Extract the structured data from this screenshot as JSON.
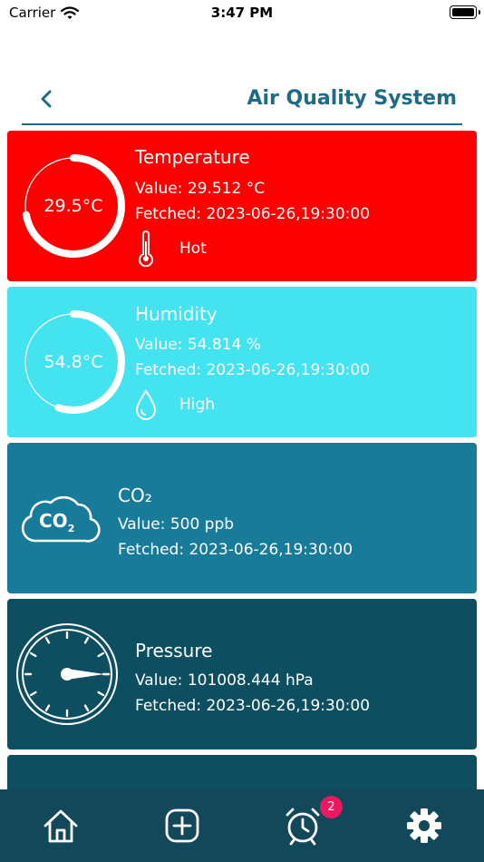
{
  "status_bar": {
    "carrier": "Carrier",
    "time": "3:47 PM"
  },
  "nav": {
    "title": "Air Quality System"
  },
  "cards": {
    "temperature": {
      "gauge_text": "29.5°C",
      "gauge_fraction": 0.72,
      "title": "Temperature",
      "value": "Value: 29.512 °C",
      "fetched": "Fetched: 2023-06-26,19:30:00",
      "status": "Hot",
      "color": "#ff0000",
      "icon": "thermometer-icon"
    },
    "humidity": {
      "gauge_text": "54.8°C",
      "gauge_fraction": 0.55,
      "title": "Humidity",
      "value": "Value: 54.814 %",
      "fetched": "Fetched: 2023-06-26,19:30:00",
      "status": "High",
      "color": "#43e3f0",
      "icon": "water-drop-icon"
    },
    "co2": {
      "title": "CO₂",
      "value": "Value: 500 ppb",
      "fetched": "Fetched: 2023-06-26,19:30:00",
      "icon_text": "CO",
      "icon_sub": "2",
      "color": "#187b99",
      "icon": "co2-cloud-icon"
    },
    "pressure": {
      "title": "Pressure",
      "value": "Value: 101008.444  hPa",
      "fetched": "Fetched: 2023-06-26,19:30:00",
      "color": "#0d4f60",
      "icon": "pressure-gauge-icon"
    }
  },
  "tab_bar": {
    "items": [
      "home-icon",
      "add-icon",
      "alarm-icon",
      "settings-icon"
    ],
    "alarm_badge": "2",
    "background": "#13475a"
  }
}
